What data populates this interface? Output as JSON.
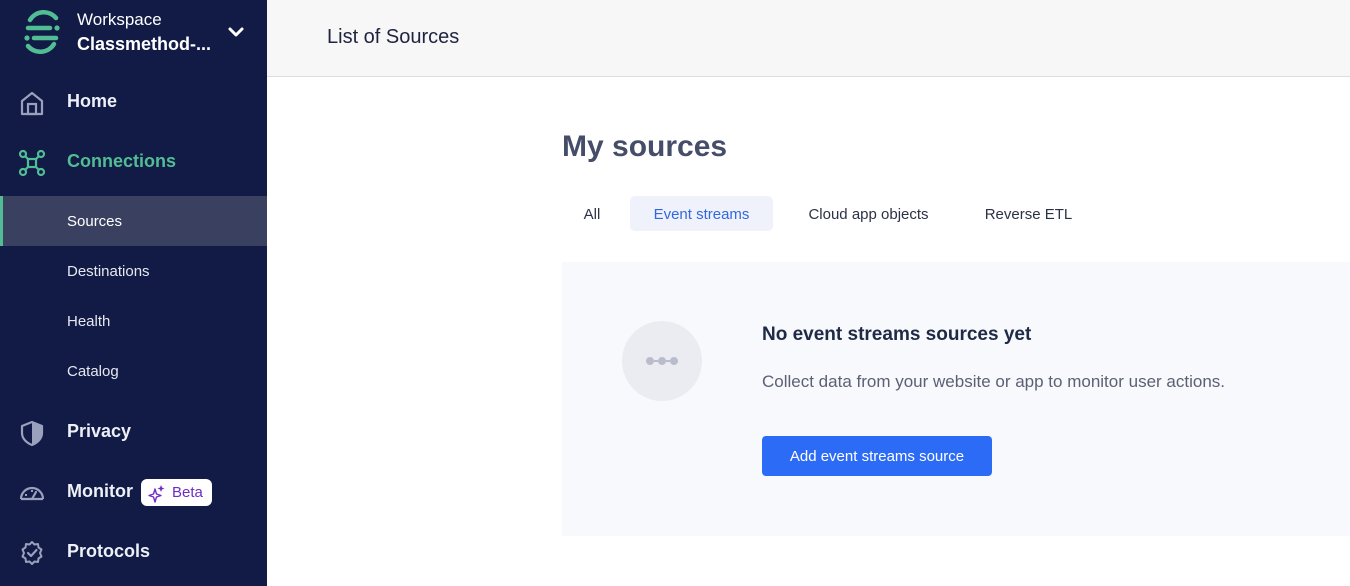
{
  "sidebar": {
    "workspace_label": "Workspace",
    "workspace_name": "Classmethod-...",
    "nav": {
      "home": "Home",
      "connections": "Connections",
      "sources": "Sources",
      "destinations": "Destinations",
      "health": "Health",
      "catalog": "Catalog",
      "privacy": "Privacy",
      "monitor": "Monitor",
      "monitor_badge": "Beta",
      "protocols": "Protocols"
    },
    "icons": [
      "segment-logo-icon",
      "chevron-down-icon",
      "home-icon",
      "connections-icon",
      "shield-icon",
      "gauge-icon",
      "sparkle-icon",
      "protocols-icon"
    ]
  },
  "header": {
    "title": "List of Sources"
  },
  "main": {
    "heading": "My sources",
    "tabs": [
      "All",
      "Event streams",
      "Cloud app objects",
      "Reverse ETL"
    ],
    "active_tab": "Event streams",
    "empty_state": {
      "title": "No event streams sources yet",
      "description": "Collect data from your website or app to monitor user actions.",
      "button_label": "Add event streams source"
    }
  },
  "colors": {
    "sidebar_bg": "#111b45",
    "accent_green": "#52bd94",
    "primary_blue": "#2c6bf6",
    "beta_purple": "#6d2ec2"
  }
}
